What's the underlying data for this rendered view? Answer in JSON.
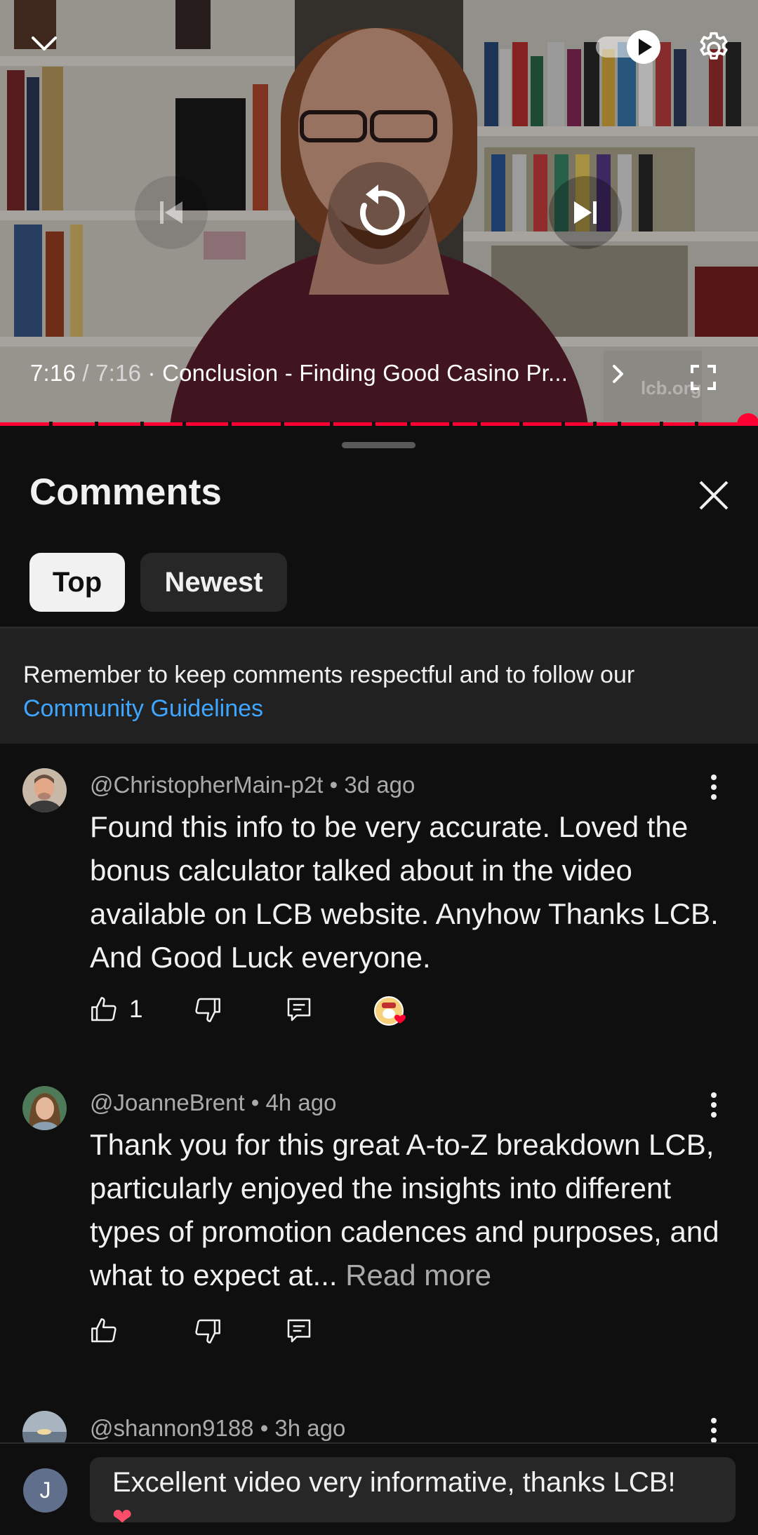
{
  "player": {
    "current_time": "7:16",
    "separator": " / ",
    "duration": "7:16",
    "chapter": " · Conclusion - Finding Good Casino Pr...",
    "watermark": "lcb.org"
  },
  "comments_panel": {
    "title": "Comments",
    "sort_tabs": [
      {
        "label": "Top",
        "selected": true
      },
      {
        "label": "Newest",
        "selected": false
      }
    ],
    "notice_text": "Remember to keep comments respectful and to follow our ",
    "notice_link": "Community Guidelines"
  },
  "comments": [
    {
      "author": "@ChristopherMain-p2t",
      "time": " • 3d ago",
      "text": "Found this info to be very accurate. Loved the bonus calculator talked about in the video available on LCB website. Anyhow Thanks LCB. And Good Luck everyone.",
      "likes": "1",
      "creator_heart": true
    },
    {
      "author": "@JoanneBrent",
      "time": " • 4h ago",
      "text": "Thank you for this great A-to-Z breakdown LCB, particularly enjoyed the insights into different types of promotion cadences and purposes, and what to expect at...",
      "read_more": " Read more"
    },
    {
      "author": "@shannon9188",
      "time": " • 3h ago"
    }
  ],
  "composer": {
    "avatar_letter": "J",
    "text": "Excellent video very informative, thanks LCB!",
    "emoji": "❤"
  },
  "colors": {
    "background": "#0f0f0f",
    "progress": "#ff0033",
    "link": "#3ea6ff",
    "secondary_text": "#aaaaaa"
  }
}
